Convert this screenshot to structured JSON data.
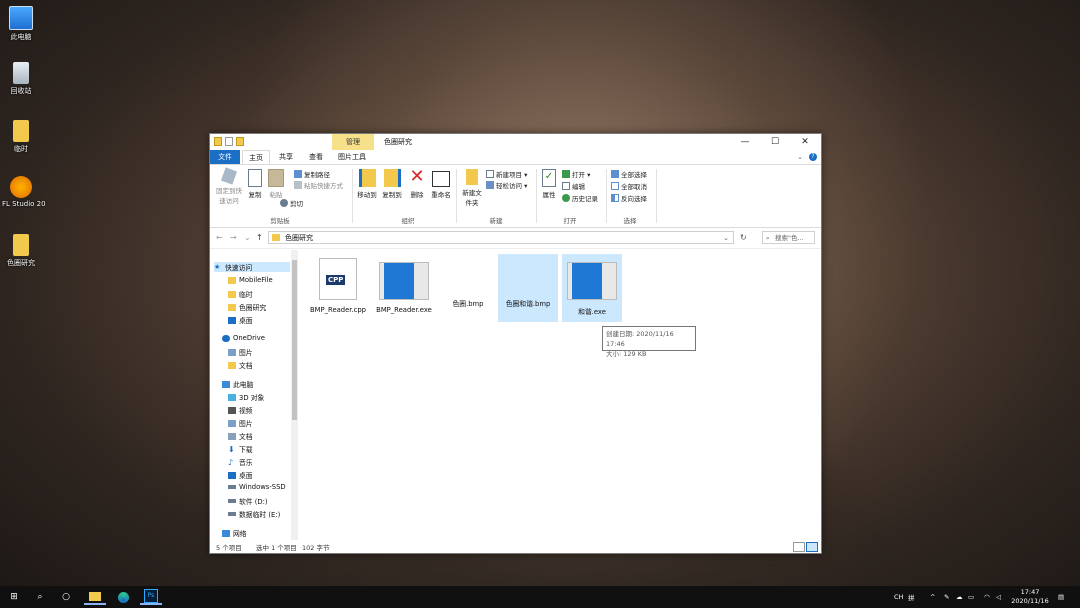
{
  "desktop": {
    "icons": [
      {
        "label": "此电脑",
        "icon": "computer-icon"
      },
      {
        "label": "回收站",
        "icon": "recycle-bin-icon"
      },
      {
        "label": "临时",
        "icon": "folder-icon"
      },
      {
        "label": "FL Studio 20",
        "icon": "fl-studio-icon"
      },
      {
        "label": "色圈研究",
        "icon": "folder-icon"
      }
    ]
  },
  "window": {
    "title": "色圈研究",
    "context_tab": "管理",
    "controls": {
      "minimize": "—",
      "maximize": "☐",
      "close": "✕"
    },
    "ribbon_tabs": [
      "文件",
      "主页",
      "共享",
      "查看",
      "图片工具"
    ],
    "ribbon": {
      "clipboard": {
        "pin": "固定到快速访问",
        "copy": "复制",
        "paste": "粘贴",
        "copy_path": "复制路径",
        "paste_shortcut": "粘贴快捷方式",
        "cut": "剪切",
        "group": "剪贴板"
      },
      "organize": {
        "move_to": "移动到",
        "copy_to": "复制到",
        "delete": "删除",
        "rename": "重命名",
        "group": "组织"
      },
      "new": {
        "new_folder": "新建文件夹",
        "new_item": "新建项目 ▾",
        "easy_access": "轻松访问 ▾",
        "group": "新建"
      },
      "open": {
        "properties": "属性",
        "open": "打开 ▾",
        "edit": "编辑",
        "history": "历史记录",
        "group": "打开"
      },
      "select": {
        "select_all": "全部选择",
        "select_none": "全部取消",
        "invert": "反向选择",
        "group": "选择"
      }
    },
    "address": {
      "back": "←",
      "forward": "→",
      "recent": "⌄",
      "up": "↑",
      "path": "色圈研究",
      "search_placeholder": "搜索\"色..."
    },
    "nav_pane": [
      {
        "label": "快速访问",
        "icon": "star-icon",
        "level": 0
      },
      {
        "label": "MobileFile",
        "icon": "folder-icon",
        "level": 1
      },
      {
        "label": "临时",
        "icon": "folder-icon",
        "level": 1
      },
      {
        "label": "色圈研究",
        "icon": "folder-icon",
        "level": 1
      },
      {
        "label": "桌面",
        "icon": "desktop-icon",
        "level": 1
      },
      {
        "label": "OneDrive",
        "icon": "cloud-icon",
        "level": 0
      },
      {
        "label": "图片",
        "icon": "pictures-icon",
        "level": 1
      },
      {
        "label": "文档",
        "icon": "folder-icon",
        "level": 1
      },
      {
        "label": "此电脑",
        "icon": "computer-icon",
        "level": 0
      },
      {
        "label": "3D 对象",
        "icon": "cube-icon",
        "level": 1
      },
      {
        "label": "视频",
        "icon": "video-icon",
        "level": 1
      },
      {
        "label": "图片",
        "icon": "pictures-icon",
        "level": 1
      },
      {
        "label": "文档",
        "icon": "document-icon",
        "level": 1
      },
      {
        "label": "下载",
        "icon": "download-icon",
        "level": 1
      },
      {
        "label": "音乐",
        "icon": "music-icon",
        "level": 1
      },
      {
        "label": "桌面",
        "icon": "desktop-icon",
        "level": 1
      },
      {
        "label": "Windows-SSD",
        "icon": "drive-icon",
        "level": 1
      },
      {
        "label": "软件 (D:)",
        "icon": "drive-icon",
        "level": 1
      },
      {
        "label": "数据临时 (E:)",
        "icon": "drive-icon",
        "level": 1
      },
      {
        "label": "网络",
        "icon": "network-icon",
        "level": 0
      }
    ],
    "files": [
      {
        "name": "BMP_Reader.cpp",
        "type": "cpp",
        "thumb_label": "CPP",
        "selected": false
      },
      {
        "name": "BMP_Reader.exe",
        "type": "exe",
        "selected": false
      },
      {
        "name": "色圈.bmp",
        "type": "bmp",
        "selected": false
      },
      {
        "name": "色圈和谐.bmp",
        "type": "bmp",
        "selected": true
      },
      {
        "name": "和谐.exe",
        "type": "exe",
        "selected": true
      }
    ],
    "tooltip": {
      "created": "创建日期: 2020/11/16 17:46",
      "size": "大小: 129 KB"
    },
    "status": {
      "count": "5 个项目",
      "selected": "选中 1 个项目",
      "size": "102 字节"
    }
  },
  "taskbar": {
    "start": "⊞",
    "search": "⌕",
    "cortana": "○",
    "ps": "Ps",
    "ime": "CH",
    "ime2": "拼",
    "time": "17:47",
    "date": "2020/11/16"
  }
}
